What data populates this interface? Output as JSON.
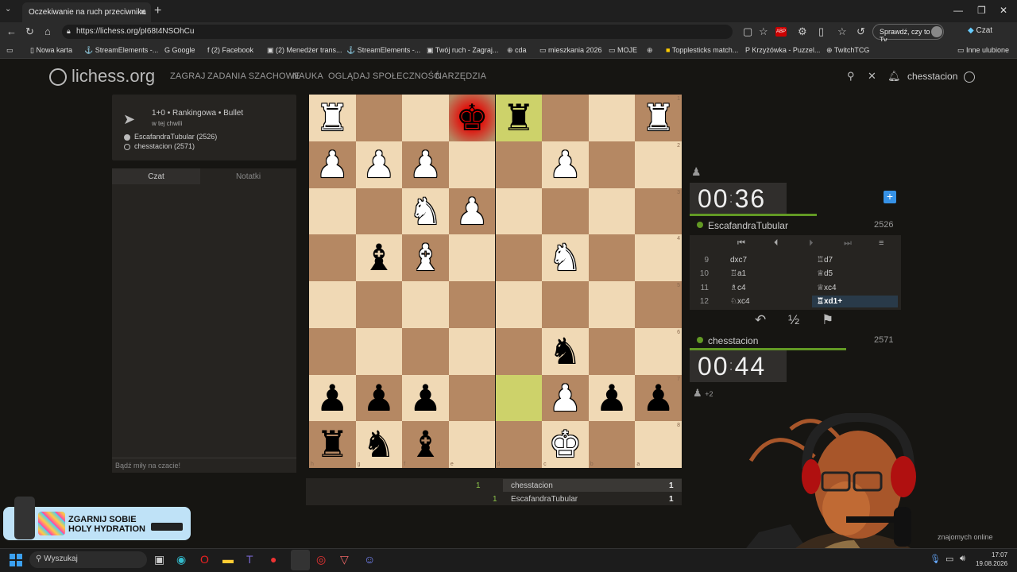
{
  "browser": {
    "tab_title": "Oczekiwanie na ruch przeciwnika",
    "url": "https://lichess.org/pI68t4NSOhCu",
    "check_button": "Sprawdź, czy to Ty",
    "chat_button": "Czat",
    "bookmarks": [
      "Nowa karta",
      "StreamElements -...",
      "Google",
      "(2) Facebook",
      "(2) Menedżer trans...",
      "StreamElements -...",
      "Twój ruch - Zagraj...",
      "cda",
      "mieszkania 2026",
      "MOJE",
      "",
      "Topplesticks match...",
      "Krzyżówka - Puzzel...",
      "TwitchTCG"
    ],
    "bookmarks_other": "Inne ulubione"
  },
  "site": {
    "logo": "lichess.org",
    "nav": [
      "ZAGRAJ",
      "ZADANIA SZACHOWE",
      "NAUKA",
      "OGLĄDAJ",
      "SPOŁECZNOŚĆ",
      "NARZĘDZIA"
    ],
    "username": "chesstacion"
  },
  "game_info": {
    "mode": "1+0 • Rankingowa • Bullet",
    "when": "w tej chwili",
    "player_black": "EscafandraTubular (2526)",
    "player_white": "chesstacion (2571)"
  },
  "chat": {
    "tab_chat": "Czat",
    "tab_notes": "Notatki",
    "placeholder": "Bądź miły na czacie!"
  },
  "board": {
    "orientation": "black",
    "rows": [
      [
        "R",
        "",
        "",
        "k",
        "r",
        "",
        "",
        "R"
      ],
      [
        "P",
        "P",
        "P",
        "",
        "",
        "P",
        "",
        ""
      ],
      [
        "",
        "",
        "N",
        "P",
        "",
        "",
        "",
        ""
      ],
      [
        "",
        "b",
        "B",
        "",
        "",
        "N",
        "",
        ""
      ],
      [
        "",
        "",
        "",
        "",
        "",
        "",
        "",
        ""
      ],
      [
        "",
        "",
        "",
        "",
        "",
        "n",
        "",
        ""
      ],
      [
        "p",
        "p",
        "p",
        "",
        "",
        "P",
        "p",
        "p"
      ],
      [
        "r",
        "n",
        "b",
        "",
        "",
        "K",
        "",
        ""
      ]
    ],
    "last_move": [
      [
        0,
        4
      ],
      [
        6,
        4
      ]
    ],
    "check": [
      0,
      3
    ],
    "rank_labels": [
      "1",
      "2",
      "3",
      "4",
      "5",
      "6",
      "7",
      "8"
    ],
    "file_labels": [
      "h",
      "g",
      "f",
      "e",
      "d",
      "c",
      "b",
      "a"
    ]
  },
  "opponent": {
    "name": "EscafandraTubular",
    "rating": "2526",
    "clock": [
      "00",
      "36"
    ],
    "clock_fill": 0.6
  },
  "player": {
    "name": "chesstacion",
    "rating": "2571",
    "clock": [
      "00",
      "44"
    ],
    "clock_fill": 0.74,
    "material": "+2"
  },
  "moves": [
    {
      "n": "9",
      "w": "dxc7",
      "b": "♖d7"
    },
    {
      "n": "10",
      "w": "♖a1",
      "b": "♕d5"
    },
    {
      "n": "11",
      "w": "♗c4",
      "b": "♕xc4"
    },
    {
      "n": "12",
      "w": "♘xc4",
      "b": "♖xd1+"
    }
  ],
  "score": [
    {
      "left": "1",
      "name": "chesstacion",
      "right": "1"
    },
    {
      "left": "1",
      "name": "EscafandraTubular",
      "right": "1"
    }
  ],
  "overlay": {
    "ad_line1": "ZGARNIJ SOBIE",
    "ad_line2": "HOLY HYDRATION",
    "online": "znajomych online"
  },
  "taskbar": {
    "search": "Wyszukaj",
    "time": "17:07",
    "date": "19.08.2026"
  }
}
